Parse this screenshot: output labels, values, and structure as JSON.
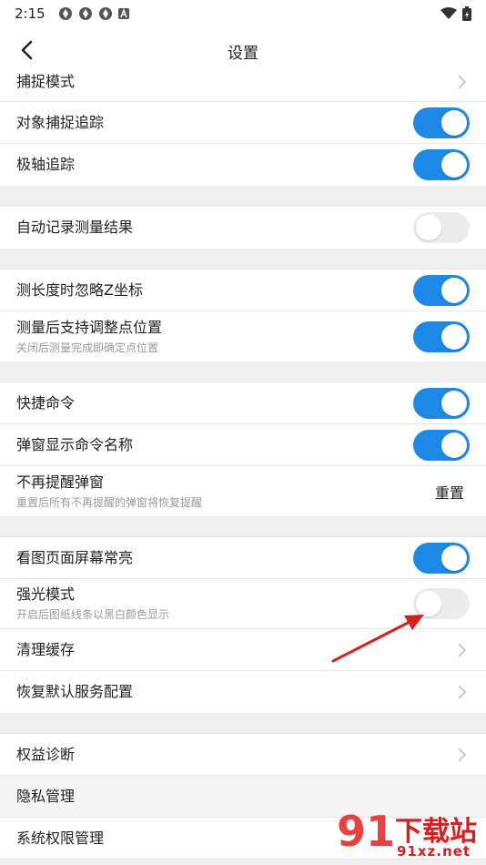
{
  "status": {
    "time": "2:15"
  },
  "nav": {
    "title": "设置"
  },
  "rows": {
    "snap_mode": "捕捉模式",
    "object_snap_tracking": "对象捕捉追踪",
    "polar_tracking": "极轴追踪",
    "auto_record_measure": "自动记录测量结果",
    "ignore_z": "测长度时忽略Z坐标",
    "adjust_point": "测量后支持调整点位置",
    "adjust_point_sub": "关闭后测量完成即确定点位置",
    "quick_command": "快捷命令",
    "popup_command_name": "弹窗显示命令名称",
    "no_remind_popup": "不再提醒弹窗",
    "no_remind_popup_sub": "重置后所有不再提醒的弹窗将恢复提醒",
    "reset_label": "重置",
    "screen_always_on": "看图页面屏幕常亮",
    "strong_light": "强光模式",
    "strong_light_sub": "开启后图纸线条以黑白颜色显示",
    "clear_cache": "清理缓存",
    "restore_default": "恢复默认服务配置",
    "rights_diagnosis": "权益诊断",
    "privacy": "隐私管理",
    "system_permission": "系统权限管理"
  },
  "toggles": {
    "object_snap_tracking": true,
    "polar_tracking": true,
    "auto_record_measure": false,
    "ignore_z": true,
    "adjust_point": true,
    "quick_command": true,
    "popup_command_name": true,
    "screen_always_on": true,
    "strong_light": false
  },
  "watermark": {
    "brand": "91",
    "name": "下载站",
    "url": "91xz.net"
  },
  "colors": {
    "accent": "#1e88e5",
    "toggle_off": "#ececec",
    "annotation_arrow": "#d42020"
  }
}
